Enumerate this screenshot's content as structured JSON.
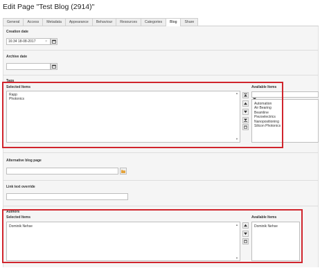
{
  "page": {
    "title": "Edit Page \"Test Blog (2914)\""
  },
  "tabs": [
    {
      "label": "General"
    },
    {
      "label": "Access"
    },
    {
      "label": "Metadata"
    },
    {
      "label": "Appearance"
    },
    {
      "label": "Behaviour"
    },
    {
      "label": "Resources"
    },
    {
      "label": "Categories"
    },
    {
      "label": "Blog"
    },
    {
      "label": "Share"
    }
  ],
  "active_tab": "Blog",
  "creation_date": {
    "label": "Creation date",
    "value": "16:34 18-08-2017",
    "clear_glyph": "×"
  },
  "archive_date": {
    "label": "Archive date",
    "value": ""
  },
  "tags": {
    "section_label": "Tags",
    "selected_label": "Selected Items",
    "available_label": "Available Items",
    "selected_items": [
      "Rapp",
      "Photonics"
    ],
    "filter_value": "",
    "available_items": [
      "Automation",
      "Air Bearing",
      "Beamline",
      "Piezoelectrics",
      "Nanopositioning",
      "Silicon Photonics"
    ]
  },
  "alternative_blog_page": {
    "label": "Alternative blog page",
    "value": ""
  },
  "link_text_override": {
    "label": "Link text override",
    "value": ""
  },
  "authors": {
    "section_label": "Authors",
    "selected_label": "Selected Items",
    "available_label": "Available Items",
    "selected_items": [
      "Dominik Nehse"
    ],
    "available_items": [
      "Dominik Nehse"
    ]
  },
  "colors": {
    "highlight": "#d0242c",
    "panel_bg": "#f5f5f5"
  }
}
